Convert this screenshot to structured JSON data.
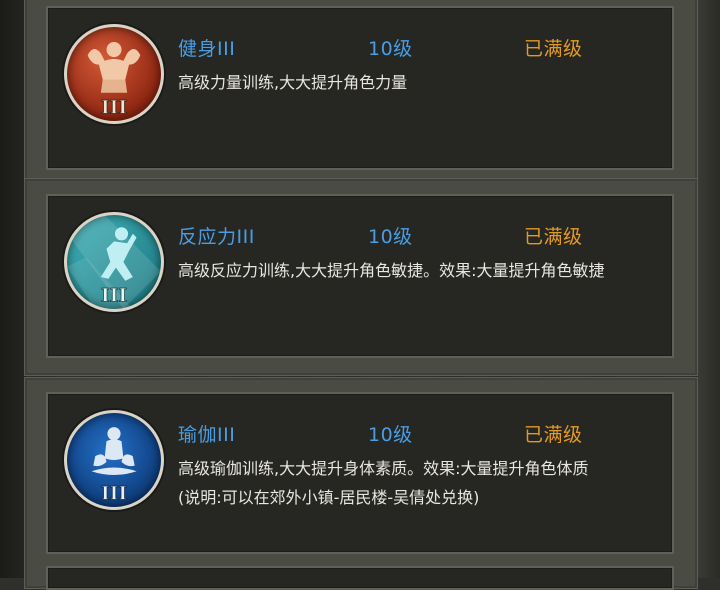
{
  "skills": [
    {
      "name": "健身III",
      "level": "10级",
      "status": "已满级",
      "description": "高级力量训练,大大提升角色力量",
      "icon": "bodybuilder-icon",
      "color": "#b8401f"
    },
    {
      "name": "反应力III",
      "level": "10级",
      "status": "已满级",
      "description": "高级反应力训练,大大提升角色敏捷。效果:大量提升角色敏捷",
      "icon": "reflex-fighter-icon",
      "color": "#2a95a0"
    },
    {
      "name": "瑜伽III",
      "level": "10级",
      "status": "已满级",
      "description": "高级瑜伽训练,大大提升身体素质。效果:大量提升角色体质",
      "note": "(说明:可以在郊外小镇-居民楼-吴倩处兑换)",
      "icon": "yoga-meditation-icon",
      "color": "#1657a8"
    }
  ],
  "colors": {
    "title": "#4a9de2",
    "status": "#e39a25",
    "text": "#e8e6df"
  }
}
